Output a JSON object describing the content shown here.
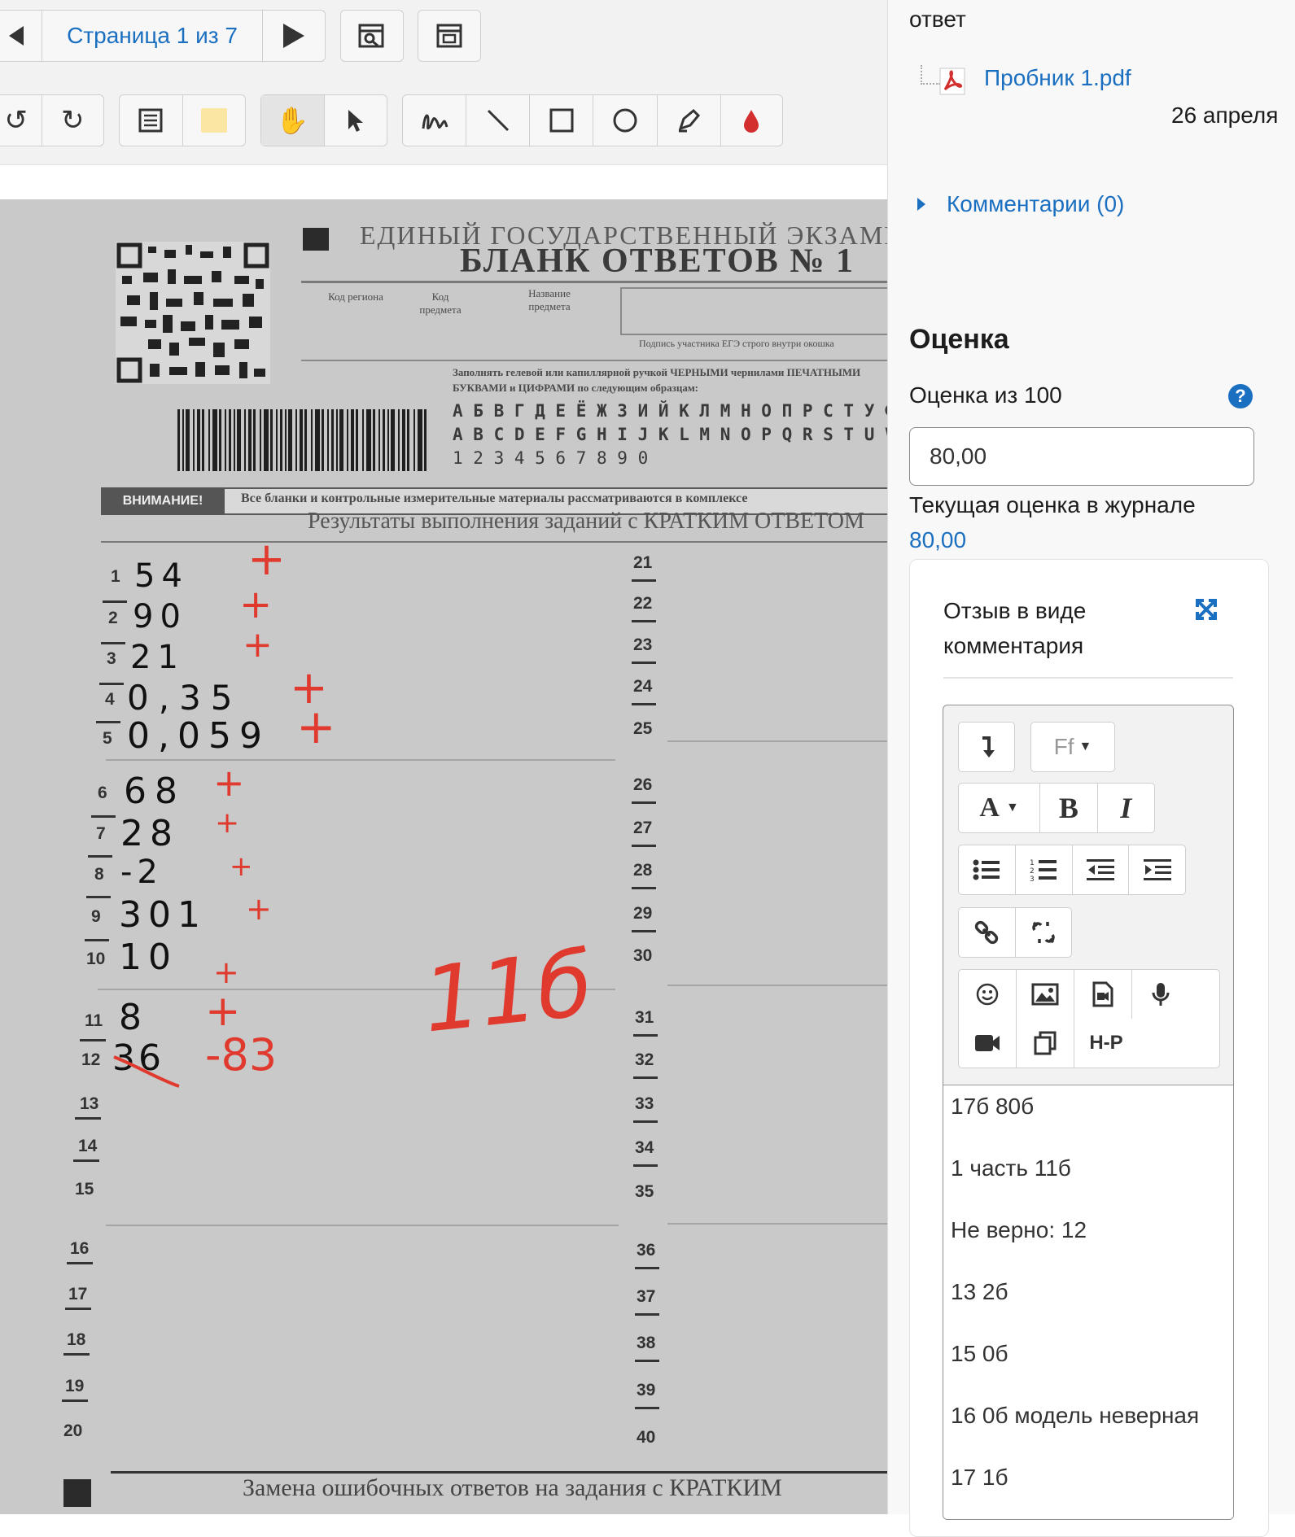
{
  "viewer": {
    "page_label": "Страница 1 из 7",
    "scan": {
      "header_top": "ЕДИНЫЙ ГОСУДАРСТВЕННЫЙ ЭКЗАМЕН",
      "header_title": "БЛАНК ОТВЕТОВ № 1",
      "field_region": "Код региона",
      "field_subject_code": "Код предмета",
      "field_subject_name": "Название предмета",
      "signature_note": "Подпись участника ЕГЭ строго внутри окошка",
      "instructions": "Заполнять гелевой или капиллярной ручкой ЧЕРНЫМИ чернилами ПЕЧАТНЫМИ БУКВАМИ и ЦИФРАМИ по следующим образцам:",
      "sample_cyr": "А Б В Г Д Е Ё Ж З И Й К Л М Н О П Р С Т У Ф Х",
      "sample_lat": "A B C D E F G H I J K L M N O P Q R S T U V W",
      "sample_digits": "1 2 3 4 5 6 7 8 9 0",
      "attention_badge": "ВНИМАНИЕ!",
      "attention_text": "Все бланки и контрольные измерительные материалы рассматриваются в комплексе",
      "section_title": "Результаты выполнения заданий с КРАТКИМ ОТВЕТОМ",
      "footer_title": "Замена ошибочных ответов на задания с КРАТКИМ",
      "answers": [
        {
          "n": "1",
          "v": "54",
          "mark": "+"
        },
        {
          "n": "2",
          "v": "90",
          "mark": "+"
        },
        {
          "n": "3",
          "v": "21",
          "mark": "+"
        },
        {
          "n": "4",
          "v": "0,35",
          "mark": "+"
        },
        {
          "n": "5",
          "v": "0,059",
          "mark": "+"
        },
        {
          "n": "6",
          "v": "68",
          "mark": "+"
        },
        {
          "n": "7",
          "v": "28",
          "mark": "+"
        },
        {
          "n": "8",
          "v": "-2",
          "mark": "+"
        },
        {
          "n": "9",
          "v": "301",
          "mark": "+"
        },
        {
          "n": "10",
          "v": "10",
          "mark": "+"
        },
        {
          "n": "11",
          "v": "8",
          "mark": "+"
        },
        {
          "n": "12",
          "v": "36",
          "mark": "-83"
        }
      ],
      "empty_left": [
        "13",
        "14",
        "15",
        "16",
        "17",
        "18",
        "19",
        "20"
      ],
      "right_numbers": [
        "21",
        "22",
        "23",
        "24",
        "25",
        "26",
        "27",
        "28",
        "29",
        "30",
        "31",
        "32",
        "33",
        "34",
        "35",
        "36",
        "37",
        "38",
        "39",
        "40"
      ],
      "total_mark": "11б"
    }
  },
  "panel": {
    "answer_heading": "ответ",
    "file_name": "Пробник 1.pdf",
    "file_date": "26 апреля",
    "comments_link": "Комментарии (0)",
    "grade_heading": "Оценка",
    "grade_label": "Оценка из 100",
    "grade_value": "80,00",
    "current_grade_label": "Текущая оценка в журнале",
    "current_grade_value": "80,00",
    "feedback_title_line1": "Отзыв в виде",
    "feedback_title_line2": "комментария",
    "editor": {
      "font_button": "Ff",
      "text_color": "A",
      "bold": "B",
      "italic": "I",
      "h5p": "H-P",
      "content": [
        "17б 80б",
        "1 часть 11б",
        "Не верно: 12",
        "13 2б",
        "15 0б",
        "16 0б модель неверная",
        "17 1б"
      ]
    }
  },
  "colors": {
    "accent": "#1a6fc0",
    "red_mark": "#e03a2f",
    "help": "#1a6fc0",
    "pdf_icon": "#d32f2f"
  }
}
